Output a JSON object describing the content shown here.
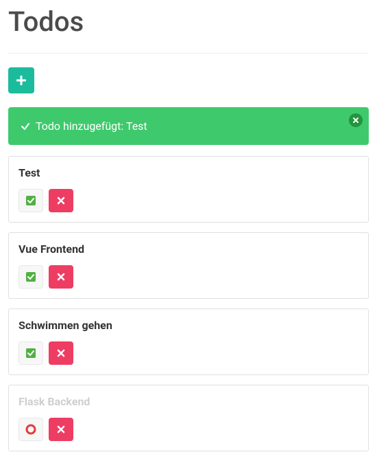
{
  "header": {
    "title": "Todos"
  },
  "buttons": {
    "add_label": "+"
  },
  "alert": {
    "icon": "check",
    "message": "Todo hinzugefügt: Test",
    "visible": true
  },
  "todos": [
    {
      "title": "Test",
      "completed": false
    },
    {
      "title": "Vue Frontend",
      "completed": false
    },
    {
      "title": "Schwimmen gehen",
      "completed": false
    },
    {
      "title": "Flask Backend",
      "completed": true
    }
  ],
  "colors": {
    "accent": "#1abc9c",
    "success": "#3fc96d",
    "danger": "#ee3d63",
    "check_green": "#52b043",
    "circle_red": "#e43a3a"
  }
}
